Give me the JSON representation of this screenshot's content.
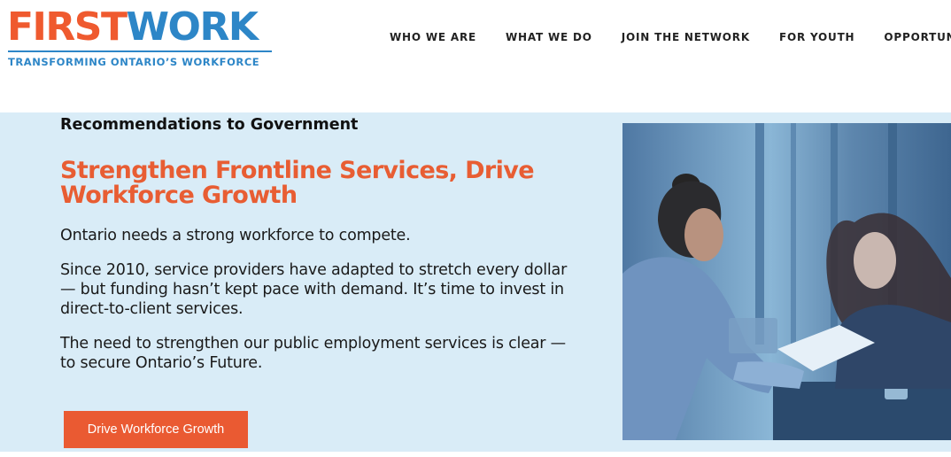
{
  "header": {
    "logo": {
      "word_first": "FIRST",
      "word_work": "WORK",
      "tagline": "TRANSFORMING ONTARIO’S WORKFORCE"
    },
    "nav": [
      {
        "label": "WHO WE ARE"
      },
      {
        "label": "WHAT WE DO"
      },
      {
        "label": "JOIN THE NETWORK"
      },
      {
        "label": "FOR YOUTH"
      },
      {
        "label": "OPPORTUNITIES"
      }
    ]
  },
  "hero": {
    "eyebrow": "Recommendations to Government",
    "headline": "Strengthen Frontline Services, Drive Workforce Growth",
    "paragraphs": [
      "Ontario needs a strong workforce to compete.",
      "Since 2010, service providers have adapted to stretch every dollar — but funding hasn’t kept pace with demand. It’s time to invest in direct-to-client services.",
      "The need to strengthen our public employment services is clear — to secure Ontario’s Future."
    ],
    "cta_label": "Drive Workforce Growth",
    "image": "two-people-reviewing-documents-photo"
  },
  "colors": {
    "brand_orange": "#ef5a2f",
    "brand_blue": "#2d86c7",
    "hero_background": "#d9ecf7",
    "cta_background": "#ea5a32"
  }
}
